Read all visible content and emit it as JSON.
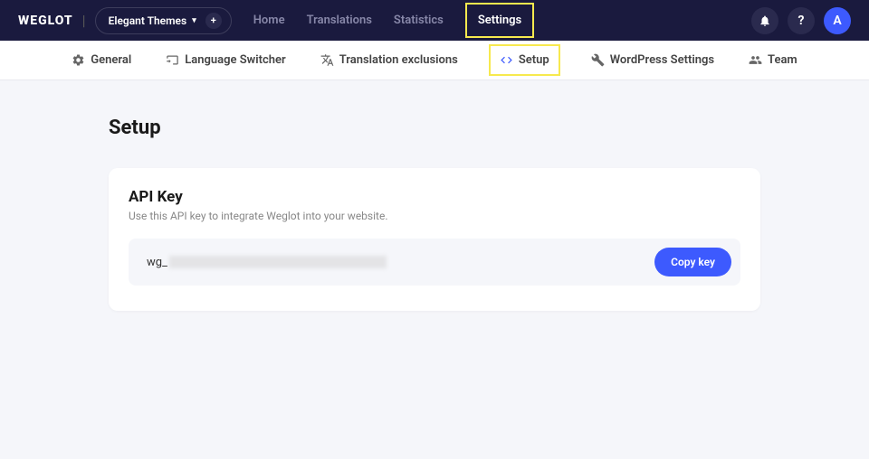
{
  "brand": "WEGLOT",
  "project_selector": {
    "label": "Elegant Themes"
  },
  "topnav": {
    "home": "Home",
    "translations": "Translations",
    "statistics": "Statistics",
    "settings": "Settings"
  },
  "avatar_initial": "A",
  "help_label": "?",
  "subnav": {
    "general": "General",
    "language_switcher": "Language Switcher",
    "translation_exclusions": "Translation exclusions",
    "setup": "Setup",
    "wordpress_settings": "WordPress Settings",
    "team": "Team"
  },
  "page": {
    "title": "Setup"
  },
  "api_card": {
    "title": "API Key",
    "subtitle": "Use this API key to integrate Weglot into your website.",
    "prefix": "wg_",
    "copy_label": "Copy key"
  }
}
